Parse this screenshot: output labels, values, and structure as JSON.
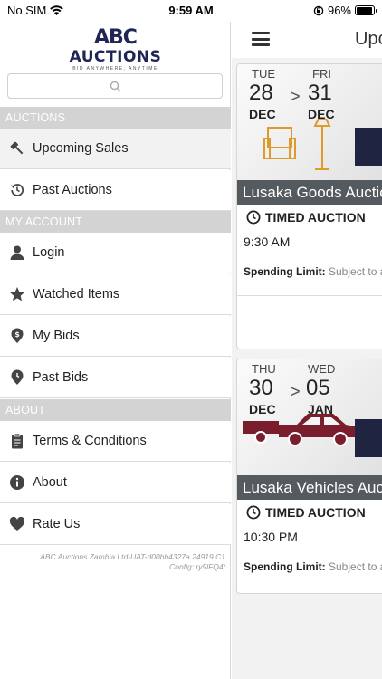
{
  "status_bar": {
    "carrier": "No SIM",
    "time": "9:59 AM",
    "battery": "96%"
  },
  "logo": {
    "line1": "ABC",
    "line2": "AUCTIONS",
    "tagline": "BID ANYWHERE, ANYTIME"
  },
  "search": {
    "placeholder": "",
    "icon": "search-icon"
  },
  "sidebar": {
    "sections": [
      {
        "title": "AUCTIONS",
        "items": [
          {
            "label": "Upcoming Sales",
            "icon": "gavel-icon",
            "active": true
          },
          {
            "label": "Past Auctions",
            "icon": "history-icon"
          }
        ]
      },
      {
        "title": "MY ACCOUNT",
        "items": [
          {
            "label": "Login",
            "icon": "user-icon"
          },
          {
            "label": "Watched Items",
            "icon": "star-icon"
          },
          {
            "label": "My Bids",
            "icon": "dollar-pin-icon"
          },
          {
            "label": "Past Bids",
            "icon": "clock-pin-icon"
          }
        ]
      },
      {
        "title": "ABOUT",
        "items": [
          {
            "label": "Terms & Conditions",
            "icon": "clipboard-icon"
          },
          {
            "label": "About",
            "icon": "info-icon"
          },
          {
            "label": "Rate Us",
            "icon": "heart-icon"
          }
        ]
      }
    ],
    "footer_line1": "ABC Auctions Zambia Ltd-UAT-d00bb4327a.24919.C1",
    "footer_line2": "Config: ry5lFQ4t"
  },
  "main": {
    "title": "Upcoming Sales",
    "cards": [
      {
        "start_dow": "TUE",
        "start_day": "28",
        "start_mon": "DEC",
        "end_dow": "FRI",
        "end_day": "31",
        "end_mon": "DEC",
        "separator": ">",
        "title": "Lusaka Goods Auction",
        "type": "TIMED AUCTION",
        "time": "9:30 AM",
        "spending_label": "Spending Limit:",
        "spending_value": "Subject to approval"
      },
      {
        "start_dow": "THU",
        "start_day": "30",
        "start_mon": "DEC",
        "end_dow": "WED",
        "end_day": "05",
        "end_mon": "JAN",
        "separator": ">",
        "title": "Lusaka Vehicles Auction",
        "type": "TIMED AUCTION",
        "time": "10:30 PM",
        "spending_label": "Spending Limit:",
        "spending_value": "Subject to approval"
      }
    ]
  },
  "colors": {
    "brand": "#1f2557",
    "section_bg": "#d3d3d3",
    "card_title_bg": "#555a5e",
    "goods_orange": "#e09a2b",
    "vehicle_red": "#7a1e2e"
  }
}
